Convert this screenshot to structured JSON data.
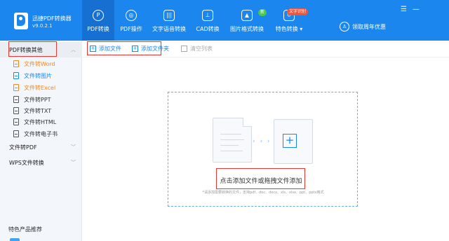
{
  "app": {
    "name": "迅捷PDF转换器",
    "version": "v9.0.2.1"
  },
  "nav": [
    {
      "label": "PDF转换",
      "icon": "pdf-convert-icon",
      "glyph": "P"
    },
    {
      "label": "PDF操作",
      "icon": "pdf-operate-icon",
      "glyph": "◎"
    },
    {
      "label": "文字语音转换",
      "icon": "speech-icon",
      "glyph": "|||"
    },
    {
      "label": "CAD转换",
      "icon": "cad-icon",
      "glyph": "⊥"
    },
    {
      "label": "图片格式转换",
      "icon": "image-icon",
      "glyph": "▲",
      "badge": "新"
    },
    {
      "label": "特色转换",
      "icon": "feature-icon",
      "glyph": "↻",
      "badge": "文字识别",
      "dropdown": "▾"
    }
  ],
  "promo": {
    "label": "领取周年优惠",
    "glyph": "♙"
  },
  "window": {
    "menu": "☰",
    "minimize": "—"
  },
  "sidebar": {
    "group1": {
      "label": "PDF转换其他",
      "chev": "︿"
    },
    "items": [
      {
        "label": "文件转Word",
        "style": "orange"
      },
      {
        "label": "文件转图片",
        "style": "blue"
      },
      {
        "label": "文件转Excel",
        "style": "orange"
      },
      {
        "label": "文件转PPT",
        "style": "normal"
      },
      {
        "label": "文件转TXT",
        "style": "normal"
      },
      {
        "label": "文件转HTML",
        "style": "normal"
      },
      {
        "label": "文件转电子书",
        "style": "normal"
      }
    ],
    "group2": {
      "label": "文件转PDF",
      "chev": "﹀"
    },
    "group3": {
      "label": "WPS文件转换",
      "chev": "﹀"
    },
    "footer": "特色产品推荐"
  },
  "toolbar": {
    "add_file": "添加文件",
    "add_folder": "添加文件夹",
    "clear_list": "清空列表"
  },
  "dropzone": {
    "arrows": "› › ›",
    "plus": "+",
    "main_text": "点击添加文件或拖拽文件添加",
    "hint": "*请添加需要转换的文件，支持pdf、doc、docx、xls、xlsx、ppt、pptx格式"
  },
  "colors": {
    "accent": "#1a86ee",
    "highlight": "#e53935"
  }
}
